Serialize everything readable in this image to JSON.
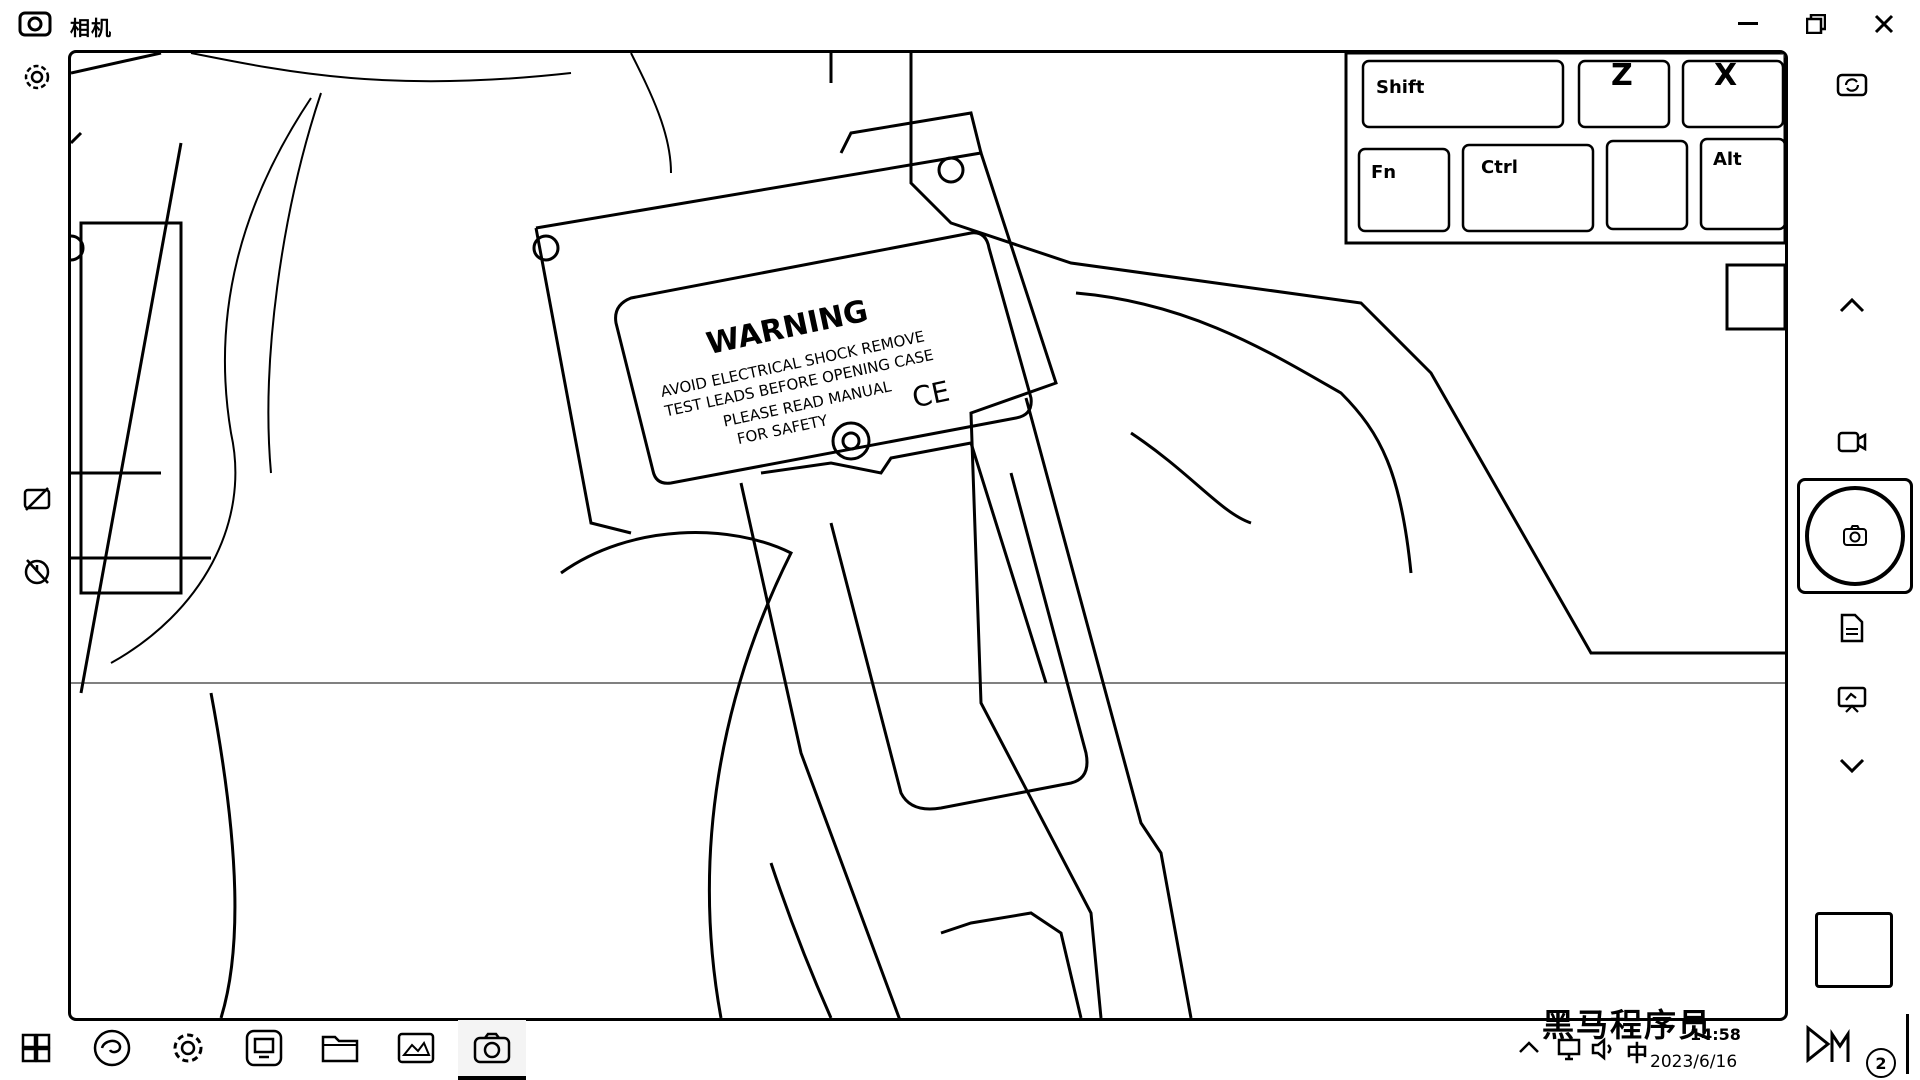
{
  "window": {
    "title": "相机",
    "minimize_icon": "minimize-icon",
    "maximize_icon": "restore-icon",
    "close_icon": "close-icon"
  },
  "left_rail": {
    "settings_icon": "gear-icon",
    "icons": [
      "hdr-off-icon",
      "timer-off-icon"
    ]
  },
  "right_rail": {
    "icons": [
      "switch-camera-icon",
      "chevron-up-icon",
      "video-mode-icon",
      "photo-mode-icon",
      "document-mode-icon",
      "whiteboard-mode-icon",
      "chevron-down-icon"
    ],
    "shutter_icon": "camera-shutter-icon"
  },
  "scene": {
    "label_title": "WARNING",
    "label_lines": [
      "AVOID ELECTRICAL SHOCK REMOVE",
      "TEST LEADS BEFORE OPENING CASE",
      "PLEASE READ MANUAL",
      "FOR SAFETY"
    ],
    "ce_mark": "CE",
    "keys": [
      "Shift",
      "Z",
      "X",
      "Fn",
      "Ctrl",
      "Alt"
    ]
  },
  "taskbar": {
    "items": [
      "start-icon",
      "edge-browser-icon",
      "settings-app-icon",
      "remote-desktop-icon",
      "file-explorer-icon",
      "photos-icon",
      "camera-app-icon"
    ],
    "active": "camera-app-icon"
  },
  "tray": {
    "ime": "中",
    "time": "14:58",
    "date": "2023/6/16",
    "notifications": "2"
  },
  "watermark": "黑马程序员"
}
